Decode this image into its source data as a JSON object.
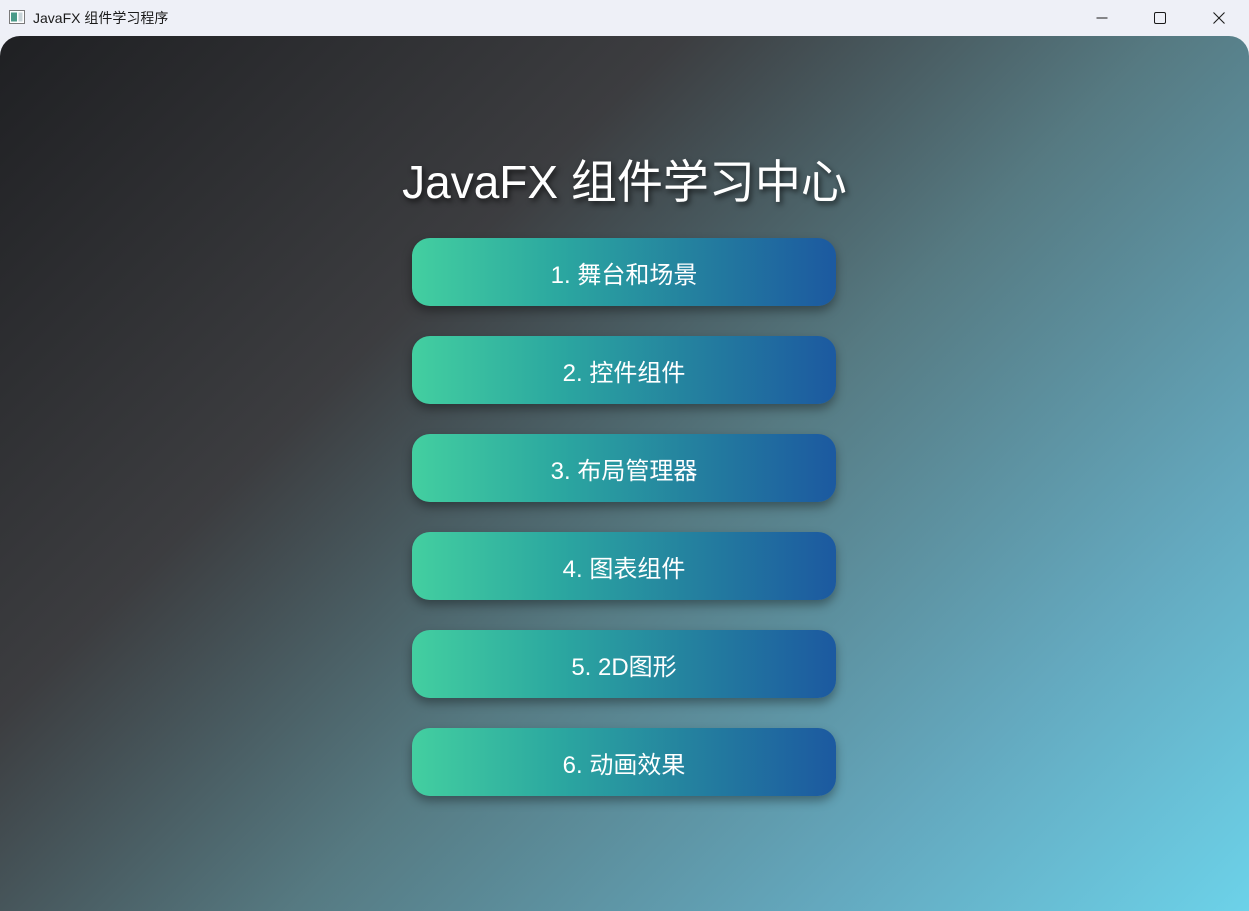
{
  "window": {
    "title": "JavaFX 组件学习程序",
    "icon": "app-window-icon",
    "controls": {
      "minimize_icon": "minimize-icon",
      "maximize_icon": "maximize-icon",
      "close_icon": "close-icon"
    }
  },
  "main": {
    "heading": "JavaFX 组件学习中心",
    "buttons": [
      {
        "label": "1. 舞台和场景"
      },
      {
        "label": "2. 控件组件"
      },
      {
        "label": "3. 布局管理器"
      },
      {
        "label": "4. 图表组件"
      },
      {
        "label": "5. 2D图形"
      },
      {
        "label": "6. 动画效果"
      }
    ]
  },
  "colors": {
    "button_gradient_start": "#43cfa0",
    "button_gradient_end": "#1c59a0",
    "background_start": "#1f2023",
    "background_end": "#6cd2e9"
  }
}
